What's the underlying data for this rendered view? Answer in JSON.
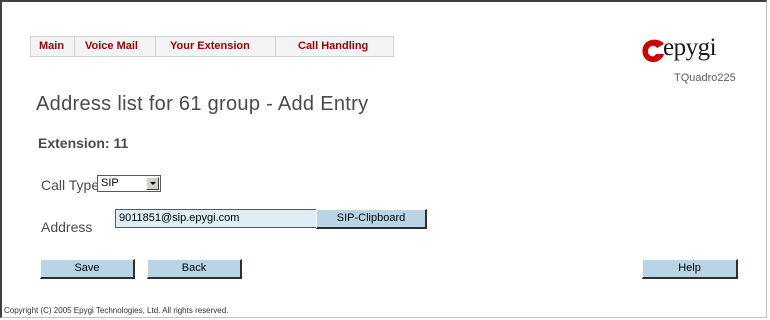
{
  "menu": {
    "items": [
      {
        "label": "Main"
      },
      {
        "label": "Voice Mail"
      },
      {
        "label": "Your Extension"
      },
      {
        "label": "Call Handling"
      }
    ]
  },
  "branding": {
    "logo_text": "epygi",
    "model": "TQuadro225",
    "logo_color": "#cc0000"
  },
  "page": {
    "title": "Address list for 61 group - Add Entry",
    "extension_label": "Extension: 11"
  },
  "form": {
    "call_type_label": "Call Type",
    "call_type_value": "SIP",
    "address_label": "Address",
    "address_value": "9011851@sip.epygi.com",
    "sip_clipboard_button": "SIP-Clipboard"
  },
  "buttons": {
    "save": "Save",
    "back": "Back",
    "help": "Help"
  },
  "footer": {
    "copyright": "Copyright (C) 2005 Epygi Technologies, Ltd. All rights reserved."
  },
  "colors": {
    "menu_text": "#a00000",
    "button_bg": "#b9d4e5",
    "input_bg": "#ddeef5",
    "text_gray": "#4a4a4a"
  }
}
